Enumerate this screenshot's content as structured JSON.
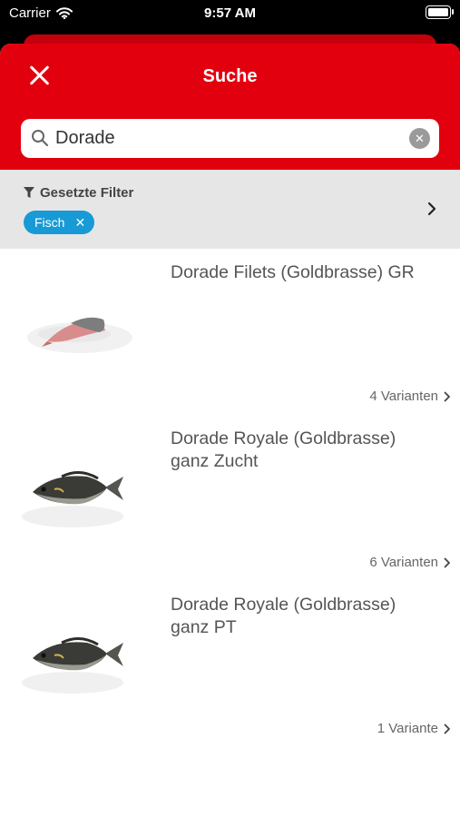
{
  "status_bar": {
    "carrier": "Carrier",
    "time": "9:57 AM",
    "battery_level": 1.0
  },
  "header": {
    "title": "Suche",
    "close_icon": "close-icon",
    "background_color": "#e2000f"
  },
  "search": {
    "value": "Dorade",
    "placeholder": "",
    "clear_icon": "clear-icon"
  },
  "filters": {
    "title": "Gesetzte Filter",
    "title_icon": "filter-icon",
    "chips": [
      {
        "label": "Fisch",
        "remove_label": "✕"
      }
    ],
    "chip_color": "#179ad6"
  },
  "products": [
    {
      "name": "Dorade Filets (Goldbrasse) GR",
      "variants": "4 Varianten",
      "image": "fish-fillet-image"
    },
    {
      "name": "Dorade Royale (Goldbrasse) ganz Zucht",
      "variants": "6 Varianten",
      "image": "whole-fish-image"
    },
    {
      "name": "Dorade Royale (Goldbrasse) ganz PT",
      "variants": "1 Variante",
      "image": "whole-fish-image"
    }
  ]
}
